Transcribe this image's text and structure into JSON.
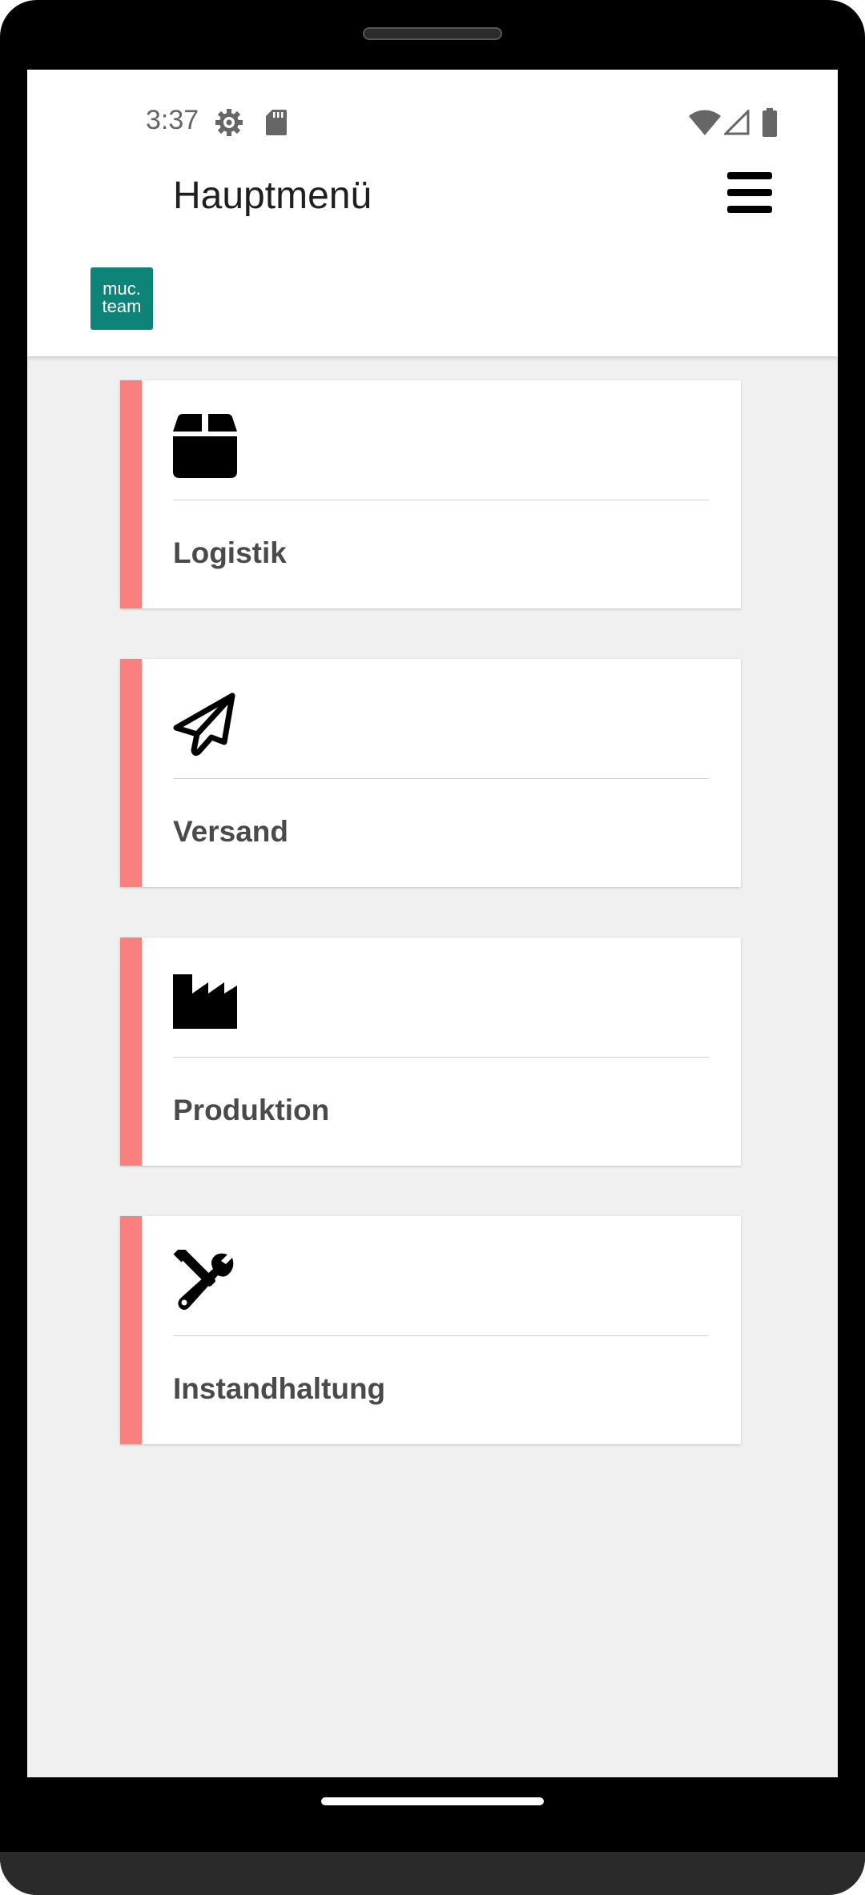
{
  "status_bar": {
    "time": "3:37"
  },
  "app_bar": {
    "logo": {
      "line1": "muc.",
      "line2": "team",
      "color": "#0e8479"
    },
    "title": "Hauptmenü"
  },
  "accent_color": "#fa8080",
  "menu_items": [
    {
      "label": "Logistik",
      "icon": "box-icon"
    },
    {
      "label": "Versand",
      "icon": "paper-plane-icon"
    },
    {
      "label": "Produktion",
      "icon": "factory-icon"
    },
    {
      "label": "Instandhaltung",
      "icon": "tools-icon"
    }
  ]
}
